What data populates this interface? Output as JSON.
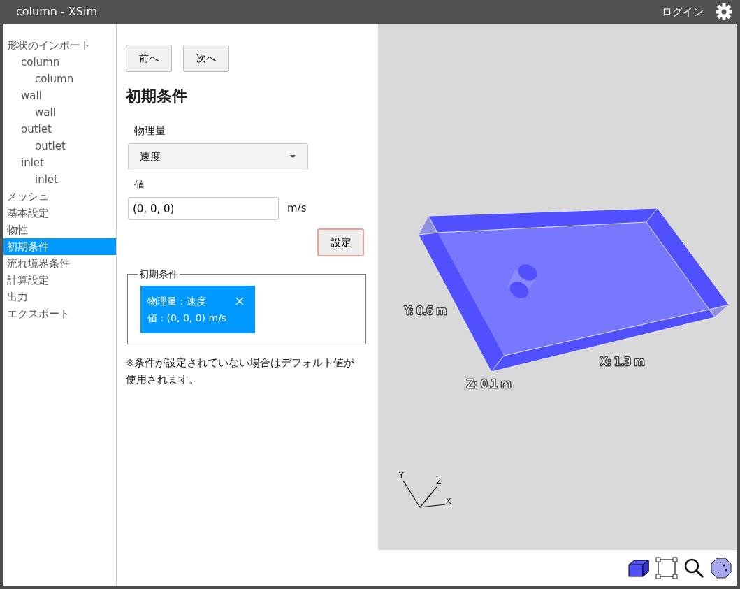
{
  "window": {
    "title": "column - XSim"
  },
  "header": {
    "login": "ログイン"
  },
  "sidebar": {
    "items": [
      {
        "label": "形状のインポート",
        "selected": false,
        "children": [
          {
            "label": "column",
            "selected": false,
            "children": [
              {
                "label": "column",
                "selected": false
              }
            ]
          },
          {
            "label": "wall",
            "selected": false,
            "children": [
              {
                "label": "wall",
                "selected": false
              }
            ]
          },
          {
            "label": "outlet",
            "selected": false,
            "children": [
              {
                "label": "outlet",
                "selected": false
              }
            ]
          },
          {
            "label": "inlet",
            "selected": false,
            "children": [
              {
                "label": "inlet",
                "selected": false
              }
            ]
          }
        ]
      },
      {
        "label": "メッシュ",
        "selected": false
      },
      {
        "label": "基本設定",
        "selected": false
      },
      {
        "label": "物性",
        "selected": false
      },
      {
        "label": "初期条件",
        "selected": true
      },
      {
        "label": "流れ境界条件",
        "selected": false
      },
      {
        "label": "計算設定",
        "selected": false
      },
      {
        "label": "出力",
        "selected": false
      },
      {
        "label": "エクスポート",
        "selected": false
      }
    ]
  },
  "nav_buttons": [
    "前へ",
    "次へ"
  ],
  "heading": "初期条件",
  "form": {
    "quantity_label": "物理量",
    "quantity_value": "速度",
    "value_label": "値",
    "value": "(0, 0, 0)",
    "unit": "m/s",
    "set_button": "設定"
  },
  "conditions": {
    "legend": "初期条件",
    "items": [
      {
        "quantity": "物理量 : 速度",
        "value": "値 : (0, 0, 0) m/s"
      }
    ]
  },
  "note": "※条件が設定されていない場合はデフォルト値が使用されます。",
  "viewer": {
    "dimension_labels": {
      "y": "Y: 0.6 m",
      "x": "X: 1.3 m",
      "z": "Z: 0.1 m"
    },
    "axes": {
      "x": "X",
      "y": "Y",
      "z": "Z"
    }
  }
}
